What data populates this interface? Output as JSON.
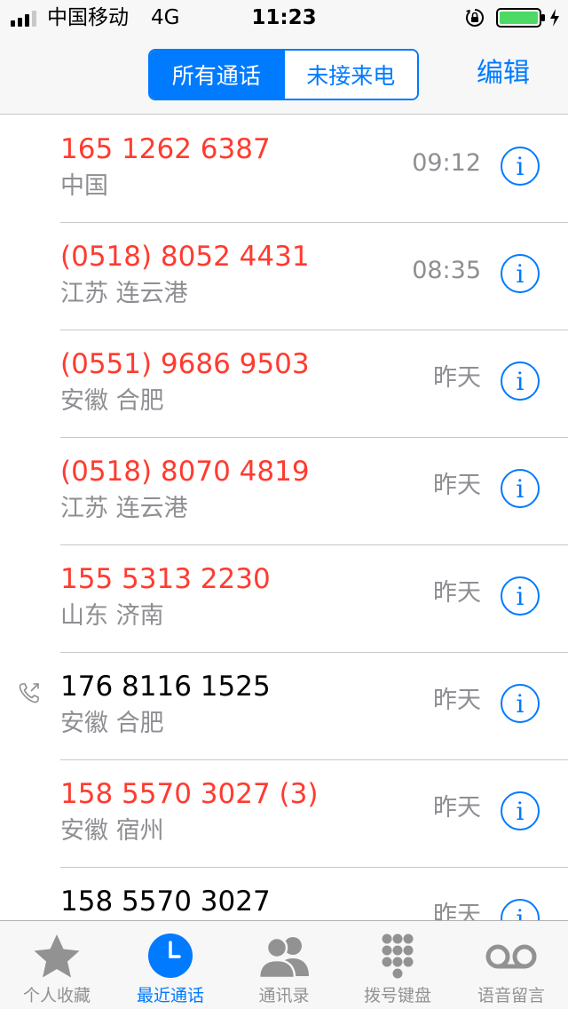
{
  "status_bar": {
    "carrier": "中国移动",
    "network": "4G",
    "time": "11:23",
    "battery_color": "#4cd964"
  },
  "nav": {
    "segments": [
      {
        "label": "所有通话",
        "selected": true
      },
      {
        "label": "未接来电",
        "selected": false
      }
    ],
    "edit_label": "编辑"
  },
  "calls": [
    {
      "number": "165 1262 6387",
      "location": "中国",
      "time": "09:12",
      "missed": true,
      "outgoing": false
    },
    {
      "number": "(0518) 8052 4431",
      "location": "江苏 连云港",
      "time": "08:35",
      "missed": true,
      "outgoing": false
    },
    {
      "number": "(0551) 9686 9503",
      "location": "安徽 合肥",
      "time": "昨天",
      "missed": true,
      "outgoing": false
    },
    {
      "number": "(0518) 8070 4819",
      "location": "江苏 连云港",
      "time": "昨天",
      "missed": true,
      "outgoing": false
    },
    {
      "number": "155 5313 2230",
      "location": "山东 济南",
      "time": "昨天",
      "missed": true,
      "outgoing": false
    },
    {
      "number": "176 8116 1525",
      "location": "安徽 合肥",
      "time": "昨天",
      "missed": false,
      "outgoing": true
    },
    {
      "number": "158 5570 3027 (3)",
      "location": "安徽 宿州",
      "time": "昨天",
      "missed": true,
      "outgoing": false
    },
    {
      "number": "158 5570 3027",
      "location": "",
      "time": "昨天",
      "missed": false,
      "outgoing": false
    }
  ],
  "info_glyph": "i",
  "tabs": [
    {
      "label": "个人收藏",
      "icon": "star-icon",
      "active": false
    },
    {
      "label": "最近通话",
      "icon": "clock-icon",
      "active": true
    },
    {
      "label": "通讯录",
      "icon": "contacts-icon",
      "active": false
    },
    {
      "label": "拨号键盘",
      "icon": "keypad-icon",
      "active": false
    },
    {
      "label": "语音留言",
      "icon": "voicemail-icon",
      "active": false
    }
  ],
  "colors": {
    "accent": "#007aff",
    "missed": "#ff3b30",
    "secondary_text": "#8e8e93"
  }
}
